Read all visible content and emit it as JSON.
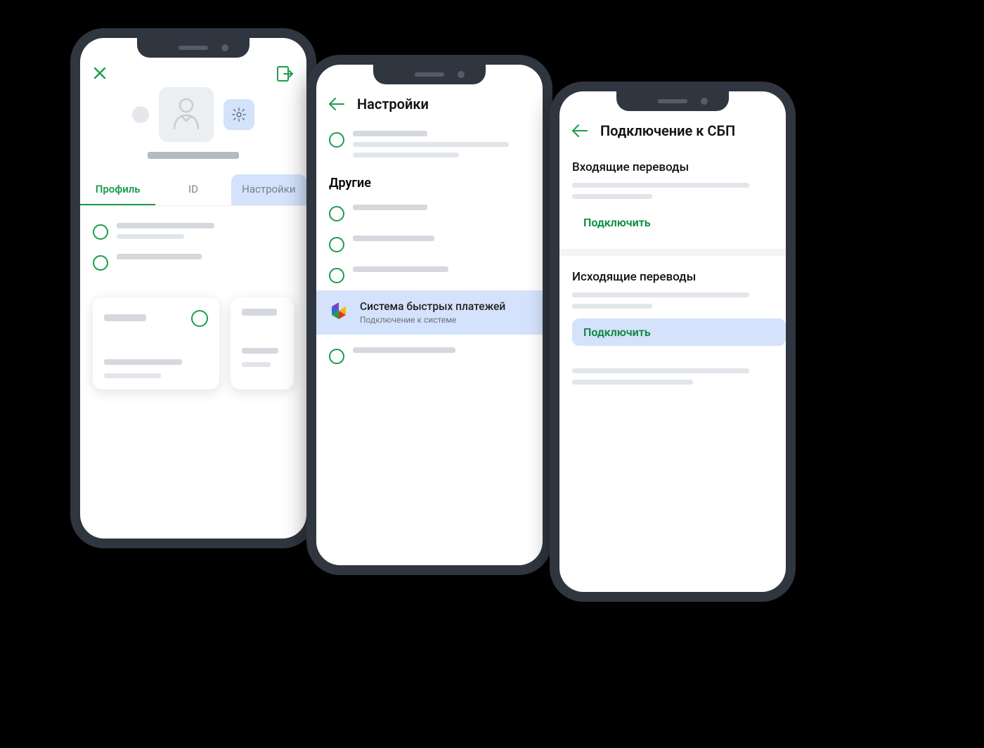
{
  "phone1": {
    "tabs": {
      "profile": "Профиль",
      "id": "ID",
      "settings": "Настройки"
    }
  },
  "phone2": {
    "title": "Настройки",
    "section_other": "Другие",
    "sbp": {
      "title": "Система быстрых платежей",
      "subtitle": "Подключение к системе"
    }
  },
  "phone3": {
    "title": "Подключение к СБП",
    "incoming": "Входящие переводы",
    "outgoing": "Исходящие переводы",
    "connect": "Подключить"
  }
}
